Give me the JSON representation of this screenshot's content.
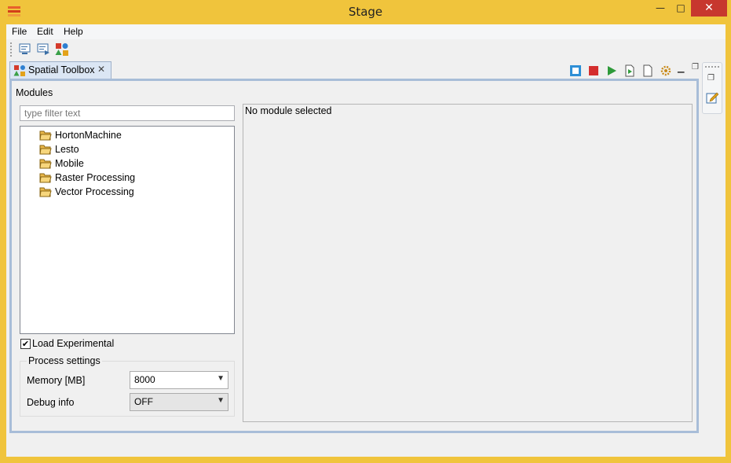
{
  "window": {
    "title": "Stage",
    "minimize": "—",
    "maximize": "□",
    "close": "✕"
  },
  "menubar": {
    "file": "File",
    "edit": "Edit",
    "help": "Help"
  },
  "tab": {
    "label": "Spatial Toolbox",
    "close_icon": "✕"
  },
  "panel": {
    "modules_label": "Modules",
    "filter_placeholder": "type filter text",
    "tree_items": [
      "HortonMachine",
      "Lesto",
      "Mobile",
      "Raster Processing",
      "Vector Processing"
    ],
    "load_experimental": "Load Experimental",
    "load_experimental_checked": true,
    "process_settings": "Process settings",
    "memory_label": "Memory [MB]",
    "memory_value": "8000",
    "debug_label": "Debug info",
    "debug_value": "OFF",
    "no_module": "No module selected"
  },
  "colors": {
    "frame": "#f0c43c",
    "close_button": "#c7372e",
    "panel_border": "#a8bdd8",
    "tab_bg": "#dbe6f4"
  }
}
